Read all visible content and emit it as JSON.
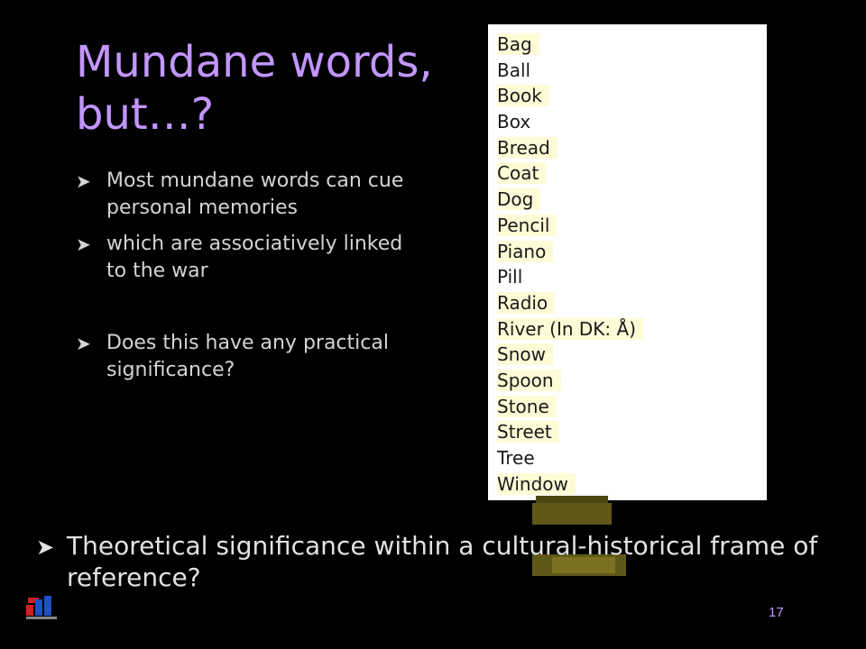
{
  "slide": {
    "title": "Mundane words, but…?",
    "bullets": [
      "Most mundane words can cue personal memories",
      "which are associatively linked to the war",
      "Does this have any practical significance?"
    ],
    "words": [
      "Bag",
      "Ball",
      "Book",
      "Box",
      "Bread",
      "Coat",
      "Dog",
      "Pencil",
      "Piano",
      "Pill",
      "Radio",
      "River (In DK: Å)",
      "Snow",
      "Spoon",
      "Stone",
      "Street",
      "Tree",
      "Window"
    ],
    "theory": "Theoretical significance within a cultural-historical frame of reference?",
    "page_number": "17",
    "bullet_glyph": "»"
  },
  "colors": {
    "background": "#000000",
    "title": "#c396ff",
    "highlight": "#fffbd6"
  }
}
